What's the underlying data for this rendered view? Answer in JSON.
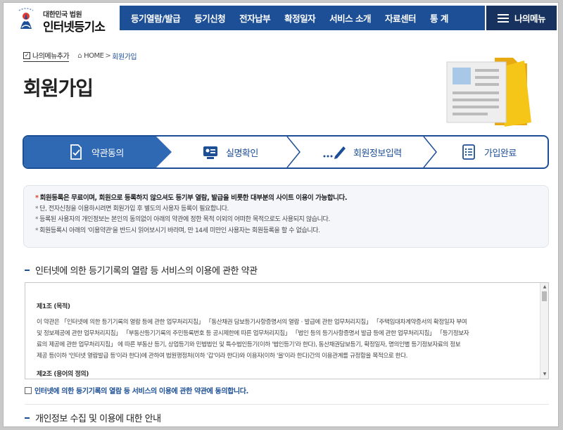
{
  "header": {
    "logo_sub": "대한민국 법원",
    "logo_main": "인터넷등기소",
    "nav": [
      "등기열람/발급",
      "등기신청",
      "전자납부",
      "확정일자",
      "서비스 소개",
      "자료센터",
      "통 계"
    ],
    "my_menu": "나의메뉴"
  },
  "breadcrumb": {
    "add_menu": "나의메뉴추가",
    "home": "HOME",
    "separator": ">",
    "current": "회원가입"
  },
  "page_title": "회원가입",
  "steps": [
    {
      "label": "약관동의",
      "icon": "document-check-icon",
      "active": true
    },
    {
      "label": "실명확인",
      "icon": "id-card-icon",
      "active": false
    },
    {
      "label": "회원정보입력",
      "icon": "pen-icon",
      "active": false
    },
    {
      "label": "가입완료",
      "icon": "document-list-icon",
      "active": false
    }
  ],
  "notice": [
    "회원등록은 무료이며, 회원으로 등록하지 않으셔도 등기부 열람, 발급을 비롯한 대부분의 사이트 이용이 가능합니다.",
    "단, 전자신청을 이용하시려면 회원가입 후 별도의 사용자 등록이 필요합니다.",
    "등록된 사용자의 개인정보는 본인의 동의없이 아래의 약관에 정한 목적 이외의 어떠한 목적으로도 사용되지 않습니다.",
    "회원등록시 아래의 '이용약관'을 반드시 읽어보시기 바라며, 만 14세 미만인 사용자는 회원등록을 할 수 없습니다."
  ],
  "terms_section": {
    "title": "인터넷에 의한 등기기록의 열람 등 서비스의 이용에 관한 약관",
    "article1_title": "제1조 (목적)",
    "article1_lines": [
      "이 약관은 「인터넷에 의한 등기기록의 열람 등에 관한 업무처리지침」 「동산채권 담보등기사항증명서의 열람ㆍ발급에 관한 업무처리지침」 「주택임대차계약증서의 확정일자 부여",
      "및 정보제공에 관한 업무처리지침」 「부동산등기기록의 주민등록번호 등 공시제한에 따른 업무처리지침」 「법인 등의 등기사항증명서 발급 등에 관한 업무처리지침」 「등기정보자",
      "료의 제공에 관한 업무처리지침」 에 따른 부동산 등기, 상업등기와 민법법인 및 특수법인등기(이하 '법인등기'라 한다), 동산채권담보등기, 확정일자, 명의인별 등기정보자료의 정보",
      "제공 등(이하 '인터넷 열람발급 등'이라 한다)에 관하여 법원행정처(이하 '갑'이라 한다)와 이용자(이하 '을'이라 한다)간의 이용관계를 규정함을 목적으로 한다."
    ],
    "article2_title": "제2조 (용어의 정의)",
    "agree_label": "인터넷에 의한 등기기록의 열람 등 서비스의 이용에 관한 약관에 동의합니다."
  },
  "privacy_section": {
    "title": "개인정보 수집 및 이용에 대한 안내"
  },
  "colors": {
    "primary": "#1d4f96",
    "dark": "#17325f",
    "accent_star": "#e0412a"
  }
}
